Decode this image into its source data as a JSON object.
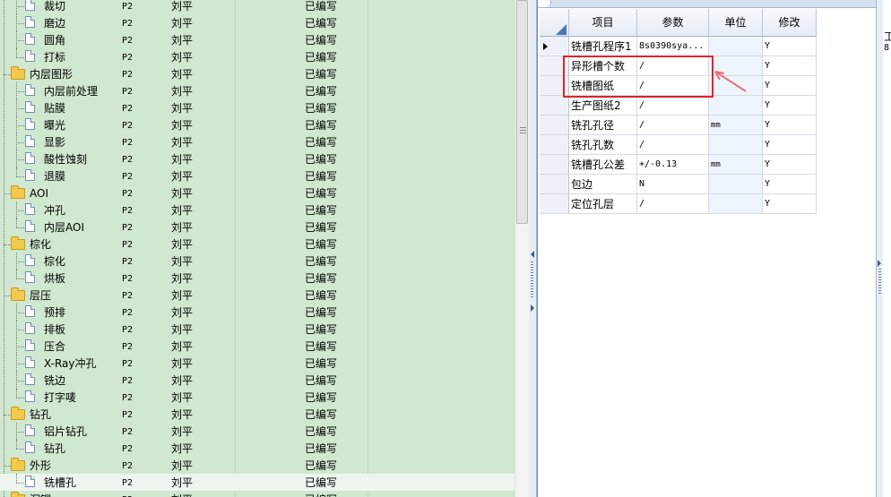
{
  "tree": {
    "rows": [
      {
        "level": 1,
        "type": "file",
        "label": "裁切",
        "rev": "P2",
        "user": "刘平",
        "status": "已编写"
      },
      {
        "level": 1,
        "type": "file",
        "label": "磨边",
        "rev": "P2",
        "user": "刘平",
        "status": "已编写"
      },
      {
        "level": 1,
        "type": "file",
        "label": "圆角",
        "rev": "P2",
        "user": "刘平",
        "status": "已编写"
      },
      {
        "level": 1,
        "type": "file",
        "label": "打标",
        "rev": "P2",
        "user": "刘平",
        "status": "已编写"
      },
      {
        "level": 0,
        "type": "folder",
        "label": "内层图形",
        "rev": "P2",
        "user": "刘平",
        "status": "已编写"
      },
      {
        "level": 1,
        "type": "file",
        "label": "内层前处理",
        "rev": "P2",
        "user": "刘平",
        "status": "已编写"
      },
      {
        "level": 1,
        "type": "file",
        "label": "贴膜",
        "rev": "P2",
        "user": "刘平",
        "status": "已编写"
      },
      {
        "level": 1,
        "type": "file",
        "label": "曝光",
        "rev": "P2",
        "user": "刘平",
        "status": "已编写"
      },
      {
        "level": 1,
        "type": "file",
        "label": "显影",
        "rev": "P2",
        "user": "刘平",
        "status": "已编写"
      },
      {
        "level": 1,
        "type": "file",
        "label": "酸性蚀刻",
        "rev": "P2",
        "user": "刘平",
        "status": "已编写"
      },
      {
        "level": 1,
        "type": "file",
        "label": "退膜",
        "rev": "P2",
        "user": "刘平",
        "status": "已编写"
      },
      {
        "level": 0,
        "type": "folder",
        "label": "AOI",
        "rev": "P2",
        "user": "刘平",
        "status": "已编写"
      },
      {
        "level": 1,
        "type": "file",
        "label": "冲孔",
        "rev": "P2",
        "user": "刘平",
        "status": "已编写"
      },
      {
        "level": 1,
        "type": "file",
        "label": "内层AOI",
        "rev": "P2",
        "user": "刘平",
        "status": "已编写"
      },
      {
        "level": 0,
        "type": "folder",
        "label": "棕化",
        "rev": "P2",
        "user": "刘平",
        "status": "已编写"
      },
      {
        "level": 1,
        "type": "file",
        "label": "棕化",
        "rev": "P2",
        "user": "刘平",
        "status": "已编写"
      },
      {
        "level": 1,
        "type": "file",
        "label": "烘板",
        "rev": "P2",
        "user": "刘平",
        "status": "已编写"
      },
      {
        "level": 0,
        "type": "folder",
        "label": "层压",
        "rev": "P2",
        "user": "刘平",
        "status": "已编写"
      },
      {
        "level": 1,
        "type": "file",
        "label": "预排",
        "rev": "P2",
        "user": "刘平",
        "status": "已编写"
      },
      {
        "level": 1,
        "type": "file",
        "label": "排板",
        "rev": "P2",
        "user": "刘平",
        "status": "已编写"
      },
      {
        "level": 1,
        "type": "file",
        "label": "压合",
        "rev": "P2",
        "user": "刘平",
        "status": "已编写"
      },
      {
        "level": 1,
        "type": "file",
        "label": "X-Ray冲孔",
        "rev": "P2",
        "user": "刘平",
        "status": "已编写"
      },
      {
        "level": 1,
        "type": "file",
        "label": "铣边",
        "rev": "P2",
        "user": "刘平",
        "status": "已编写"
      },
      {
        "level": 1,
        "type": "file",
        "label": "打字唛",
        "rev": "P2",
        "user": "刘平",
        "status": "已编写"
      },
      {
        "level": 0,
        "type": "folder",
        "label": "钻孔",
        "rev": "P2",
        "user": "刘平",
        "status": "已编写"
      },
      {
        "level": 1,
        "type": "file",
        "label": "铝片钻孔",
        "rev": "P2",
        "user": "刘平",
        "status": "已编写"
      },
      {
        "level": 1,
        "type": "file",
        "label": "钻孔",
        "rev": "P2",
        "user": "刘平",
        "status": "已编写"
      },
      {
        "level": 0,
        "type": "folder",
        "label": "外形",
        "rev": "P2",
        "user": "刘平",
        "status": "已编写"
      },
      {
        "level": 1,
        "type": "file",
        "label": "铣槽孔",
        "rev": "P2",
        "user": "刘平",
        "status": "已编写",
        "selected": true
      },
      {
        "level": 0,
        "type": "folder",
        "label": "沉铜",
        "rev": "P2",
        "user": "刘平",
        "status": "已编写"
      }
    ]
  },
  "grid": {
    "headers": {
      "item": "项目",
      "param": "参数",
      "unit": "单位",
      "modify": "修改"
    },
    "rows": [
      {
        "item": "铣槽孔程序1",
        "param": "8s0390sya...",
        "unit": "",
        "modify": "Y",
        "current": true
      },
      {
        "item": "异形槽个数",
        "param": "/",
        "unit": "",
        "modify": "Y"
      },
      {
        "item": "铣槽图纸",
        "param": "/",
        "unit": "",
        "modify": "Y"
      },
      {
        "item": "生产图纸2",
        "param": "/",
        "unit": "",
        "modify": "Y"
      },
      {
        "item": "铣孔孔径",
        "param": "/",
        "unit": "mm",
        "modify": "Y"
      },
      {
        "item": "铣孔孔数",
        "param": "/",
        "unit": "",
        "modify": "Y"
      },
      {
        "item": "铣槽孔公差",
        "param": "+/-0.13",
        "unit": "mm",
        "modify": "Y"
      },
      {
        "item": "包边",
        "param": "N",
        "unit": "",
        "modify": "Y"
      },
      {
        "item": "定位孔层",
        "param": "/",
        "unit": "",
        "modify": "Y"
      }
    ]
  },
  "right_panel": {
    "text1": "工",
    "text2": "8"
  },
  "colors": {
    "tree_bg": "#cfe8cf",
    "annotation_red": "#e0242b",
    "grid_header": "#e6ecf5"
  }
}
